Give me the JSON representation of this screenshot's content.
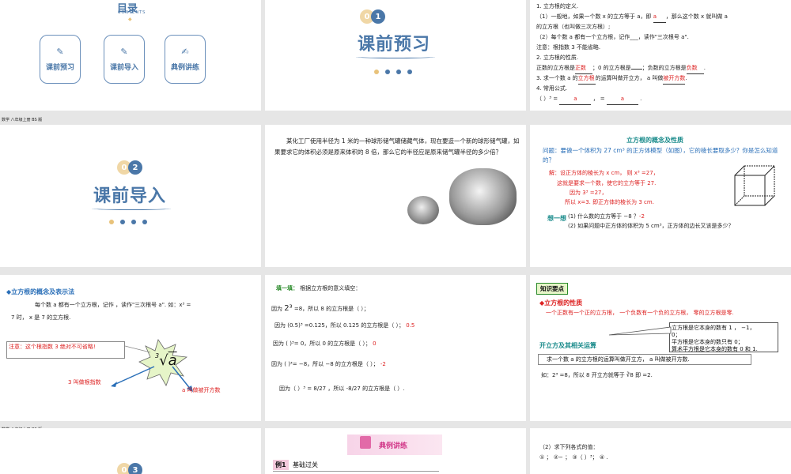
{
  "s1": {
    "title": "目录",
    "subtitle": "CONTENTS",
    "buttons": [
      "课前预习",
      "课前导入",
      "典例讲练"
    ]
  },
  "s2": {
    "num1": "0",
    "num2": "1",
    "title": "课前预习"
  },
  "s3": {
    "lines": [
      "1.  立方根的定义.",
      "（1）一般地，如果一个数  x  的立方等于  a，即",
      "的立方根（也叫做三次方根）;",
      "（2）每个数  a  都有一个立方根，记作___，读作\"三次根号  a\".",
      "注意：根指数 3 不能省略.",
      "2.  立方根的性质.",
      "正数的立方根是",
      "3.  求一个数  a  的",
      "4.  常用公式.",
      "（  ）³ ="
    ],
    "frag": {
      "a1": "，那么这个数  x  就叫做  a",
      "zero": "；0 的立方根是",
      "neg": "；负数的立方根是",
      "mid": "的运算叫做开立方，  a  叫做",
      "end": "."
    },
    "ans": {
      "a": "a",
      "zhengshu": "正数",
      "fushu": "负数",
      "lifang": "立方根",
      "beikai": "被开方数"
    }
  },
  "footer": "数学 八年级上册  BS 版",
  "s4": {
    "num1": "0",
    "num2": "2",
    "title": "课前导入"
  },
  "s5": {
    "text": "某化工厂使用半径为  1  米的一种球形储气罐储藏气体，现在要造一个新的球形储气罐，如果要求它的体积必须是原来体积的  8  倍，那么它的半径应是原来储气罐半径的多少倍？"
  },
  "s6": {
    "header": "立方根的概念及性质",
    "q": "问题：要做一个体积为   27 cm³  的正方体模型（如图），它的棱长要取多少？你是怎么知道的？",
    "sol": [
      "解：设正方体的棱长为   x cm，  则",
      "这就是要求一个数，使它的立方等于   27.",
      "因为    3³ =27，",
      "所以   x=3.  即正方体的棱长为   3 cm."
    ],
    "think": "想一想",
    "t1": "(1)  什么数的立方等于   −8 ？",
    "t1ans": "-2",
    "t2": "(2)  如果问题中正方体的体积为   5 cm³，正方体的边长又该是多少？",
    "eq": "x³ =27，"
  },
  "s7": {
    "header": "◆立方根的概念及表示法",
    "l1": "每个数   a  都有一个立方根，记作          ，读作\"三次根号   a\".   如：x³ =",
    "l2": "7  时，  x  是   7  的立方根.",
    "note": "注意：这个根指数 3  绝对不可省略!",
    "root": "3 叫做根指数",
    "rad": "a 叫做被开方数"
  },
  "s8": {
    "title": "填一填：",
    "intro": "根据立方根的意义填空：",
    "r1": "=8，所以  8  的立方根是（  ）；",
    "r2": "=0.125，所以  0.125  的立方根是（  ）；",
    "r3": "=  0，所以  0 的立方根是（  ）；",
    "r4": "=  −8，所以 −8 的立方根是（  ）；",
    "r5": "的立方根是（     ）.",
    "p1": "因为",
    "a1": "2",
    "a2": "0.5",
    "a3": "0",
    "a4": "-2",
    "pw": "2³",
    "p2": "(0.5)³",
    "p3": "(  )³",
    "p4": "(  )³",
    "p5": "因为（  ）³ =",
    "suo": "，所以",
    "frac8": "8",
    "frac27": "27",
    "m8": "-8",
    "m27": "27",
    "neg8": "−"
  },
  "s9": {
    "tag": "知识要点",
    "h1": "◆立方根的性质",
    "l1": "一个正数有一个正的立方根，  一个负数有一个负的立方根，  零的立方根是零.",
    "call": [
      "立方根是它本身的数有   1 ，  −1，",
      "0；",
      "平方根是它本身的数只有   0；",
      "算术平方根是它本身的数有   0  和  1."
    ],
    "h2": "开立方及其相关运算",
    "box": "求一个数     a  的立方根的运算叫做开立方，  a  叫做被开方数.",
    "ex": "如：2³    =8，所以  8  开立方就等于   ∛8  即        =2."
  },
  "s10": {
    "num1": "0",
    "num2": "3"
  },
  "s11": {
    "title": "典例讲练",
    "ex": "例1",
    "exlbl": "基础过关"
  },
  "s12": {
    "l1": "（2）求下列各式的值：",
    "l2": "①  ；    ②−  ；    ③（  ）³；         ④  ."
  }
}
